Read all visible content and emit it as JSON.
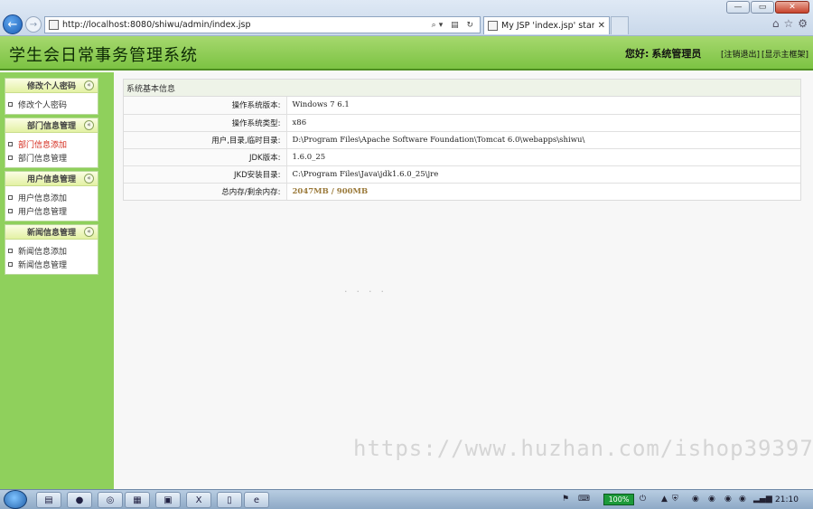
{
  "browser": {
    "url": "http://localhost:8080/shiwu/admin/index.jsp",
    "tab_title": "My JSP 'index.jsp' startin...",
    "minimize": "—",
    "restore": "▭",
    "close": "✕"
  },
  "header": {
    "title": "学生会日常事务管理系统",
    "greeting_prefix": "您好:",
    "username": "系统管理员",
    "logout": "[注销退出]",
    "show_main": "[显示主框架]"
  },
  "sidebar": {
    "groups": [
      {
        "title": "修改个人密码",
        "items": [
          "修改个人密码"
        ]
      },
      {
        "title": "部门信息管理",
        "items": [
          "部门信息添加",
          "部门信息管理"
        ]
      },
      {
        "title": "用户信息管理",
        "items": [
          "用户信息添加",
          "用户信息管理"
        ]
      },
      {
        "title": "新闻信息管理",
        "items": [
          "新闻信息添加",
          "新闻信息管理"
        ]
      }
    ],
    "collapse_glyph": "«"
  },
  "main": {
    "panel_title": "系统基本信息",
    "rows": [
      {
        "label": "操作系统版本:",
        "value": "Windows 7  6.1"
      },
      {
        "label": "操作系统类型:",
        "value": "x86"
      },
      {
        "label": "用户,目录,临时目录:",
        "value": "D:\\Program Files\\Apache Software Foundation\\Tomcat 6.0\\webapps\\shiwu\\"
      },
      {
        "label": "JDK版本:",
        "value": "1.6.0_25"
      },
      {
        "label": "JKD安装目录:",
        "value": "C:\\Program Files\\Java\\jdk1.6.0_25\\jre"
      },
      {
        "label": "总内存/剩余内存:",
        "value_total": "2047MB",
        "separator": " / ",
        "value_free": "900MB"
      }
    ],
    "watermark": "https://www.huzhan.com/ishop39397"
  },
  "taskbar": {
    "battery": "100%",
    "clock": "21:10"
  },
  "colors": {
    "header_green": "#7cc343",
    "sidebar_green": "#8fd05c",
    "active_link": "#d42a1c"
  }
}
